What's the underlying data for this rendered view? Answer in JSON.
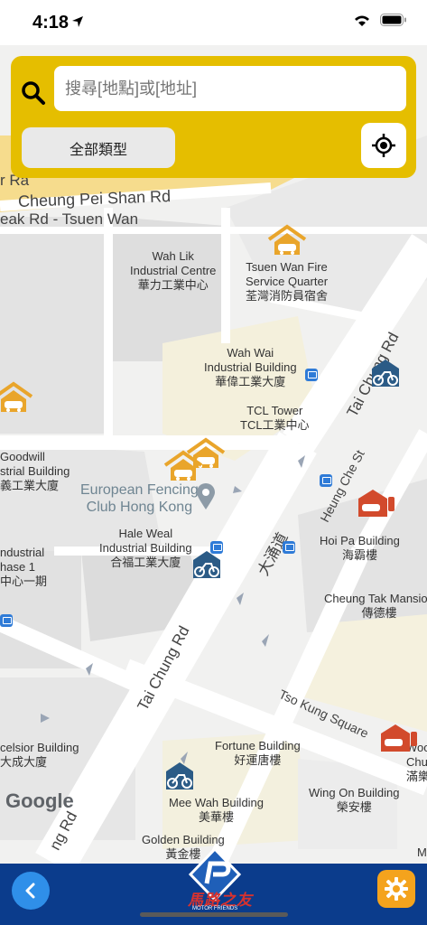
{
  "status": {
    "time": "4:18"
  },
  "search": {
    "placeholder": "搜尋[地點]或[地址]",
    "filter_label": "全部類型"
  },
  "map": {
    "roads": {
      "cheung_pei_shan": "Cheung Pei Shan Rd",
      "tsuen_wan_top": "eak Rd - Tsuen Wan",
      "r_ra": "r Ra",
      "tai_chung_right": "Tai Chung Rd",
      "tai_chung_left": "Tai Chung Rd",
      "heung_che": "Heung Che St",
      "tai_yung": "大涌道",
      "tso_kung": "Tso Kung Square",
      "tai_chung_bottom": "ng Rd"
    },
    "buildings": [
      {
        "en": "Wah Lik",
        "en2": "Industrial Centre",
        "zh": "華力工業中心"
      },
      {
        "en": "Tsuen Wan Fire",
        "en2": "Service Quarter",
        "zh": "荃灣消防員宿舍"
      },
      {
        "en": "Wah Wai",
        "en2": "Industrial Building",
        "zh": "華偉工業大廈"
      },
      {
        "en": "TCL Tower",
        "zh": "TCL工業中心"
      },
      {
        "en": "Goodwill",
        "en2": "strial Building",
        "zh": "義工業大廈"
      },
      {
        "en": "Hale Weal",
        "en2": "Industrial Building",
        "zh": "合福工業大廈"
      },
      {
        "en": "Hoi Pa Building",
        "zh": "海霸樓"
      },
      {
        "en": "ndustrial",
        "en2": "hase 1",
        "zh": "中心一期"
      },
      {
        "en": "Cheung Tak Mansion",
        "zh": "傳德樓"
      },
      {
        "en": "celsior Building",
        "zh": "大成大廈"
      },
      {
        "en": "Fortune Building",
        "zh": "好運唐樓"
      },
      {
        "en": "Mee Wah Building",
        "zh": "美華樓"
      },
      {
        "en": "Wing On Building",
        "zh": "榮安樓"
      },
      {
        "en": "Golden Building",
        "zh": "黃金樓"
      },
      {
        "en": "Woo",
        "en2": "Chu",
        "zh": "滿樂"
      },
      {
        "en": "M"
      }
    ],
    "poi": {
      "name1": "European Fencing",
      "name2": "Club Hong Kong"
    },
    "google": "Google",
    "marker_colors": {
      "carpark": "#e9a52b",
      "motorbike": "#2b5b86",
      "ev": "#d24a2c"
    }
  },
  "bottom": {
    "logo_text": "馬路之友",
    "logo_sub": "MOTOR FRIENDS"
  }
}
